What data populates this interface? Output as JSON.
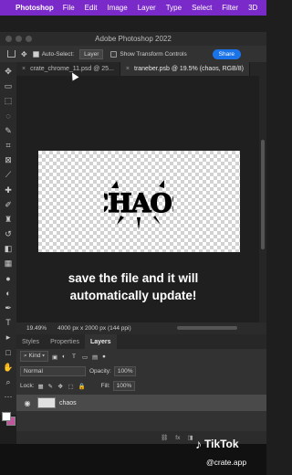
{
  "menubar": {
    "app_name": "Photoshop",
    "items": [
      "File",
      "Edit",
      "Image",
      "Layer",
      "Type",
      "Select",
      "Filter",
      "3D"
    ]
  },
  "window": {
    "title": "Adobe Photoshop 2022"
  },
  "options_bar": {
    "auto_select_label": "Auto-Select:",
    "auto_select_value": "Layer",
    "transform_controls_label": "Show Transform Controls",
    "share_label": "Share"
  },
  "tabs": [
    {
      "label": "crate_chrome_11.psd @ 25...",
      "active": false
    },
    {
      "label": "traneber.psb @ 19.5% (chaos, RGB/8)",
      "active": true
    }
  ],
  "canvas": {
    "artwork_text": "CHAOS"
  },
  "caption": {
    "line1": "save the file and it will",
    "line2": "automatically update!"
  },
  "status": {
    "zoom": "19.49%",
    "doc_info": "4000 px x 2000 px (144 ppi)"
  },
  "layers_panel": {
    "tabs": [
      "Styles",
      "Properties",
      "Layers"
    ],
    "active_tab": "Layers",
    "filter_label": "Kind",
    "blend_mode": "Normal",
    "opacity_label": "Opacity:",
    "opacity_value": "100%",
    "lock_label": "Lock:",
    "fill_label": "Fill:",
    "fill_value": "100%",
    "layers": [
      {
        "name": "chaos",
        "visible": true
      }
    ],
    "footer_fx": "fx"
  },
  "overlay": {
    "tiktok_label": "TikTok",
    "handle": "@crate.app"
  },
  "colors": {
    "menubar": "#7a2ac9",
    "share_button": "#1a73e8",
    "background_swatch": "#c0579e"
  }
}
